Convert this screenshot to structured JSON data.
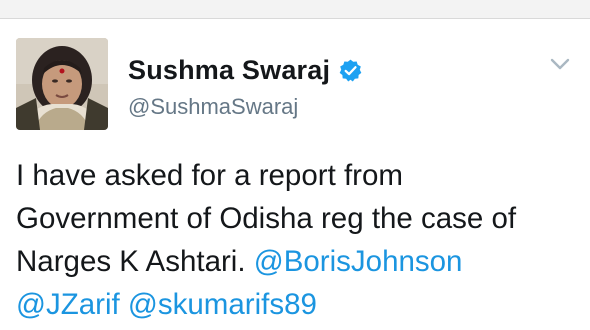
{
  "tweet": {
    "author": {
      "display_name": "Sushma Swaraj",
      "handle": "@SushmaSwaraj",
      "verified": true
    },
    "body": {
      "line1": "I have asked for a report from",
      "line2": "Government of Odisha reg the case of",
      "line3_text": "Narges K Ashtari. ",
      "line3_mention": "@BorisJohnson",
      "line4_mention1": "@JZarif",
      "line4_space": " ",
      "line4_mention2": "@skumarifs89"
    }
  },
  "colors": {
    "text": "#14171a",
    "secondary": "#657786",
    "link": "#1b95e0",
    "verified": "#1da1f2"
  },
  "icons": {
    "verified": "verified-badge-icon",
    "menu": "chevron-down-icon"
  }
}
